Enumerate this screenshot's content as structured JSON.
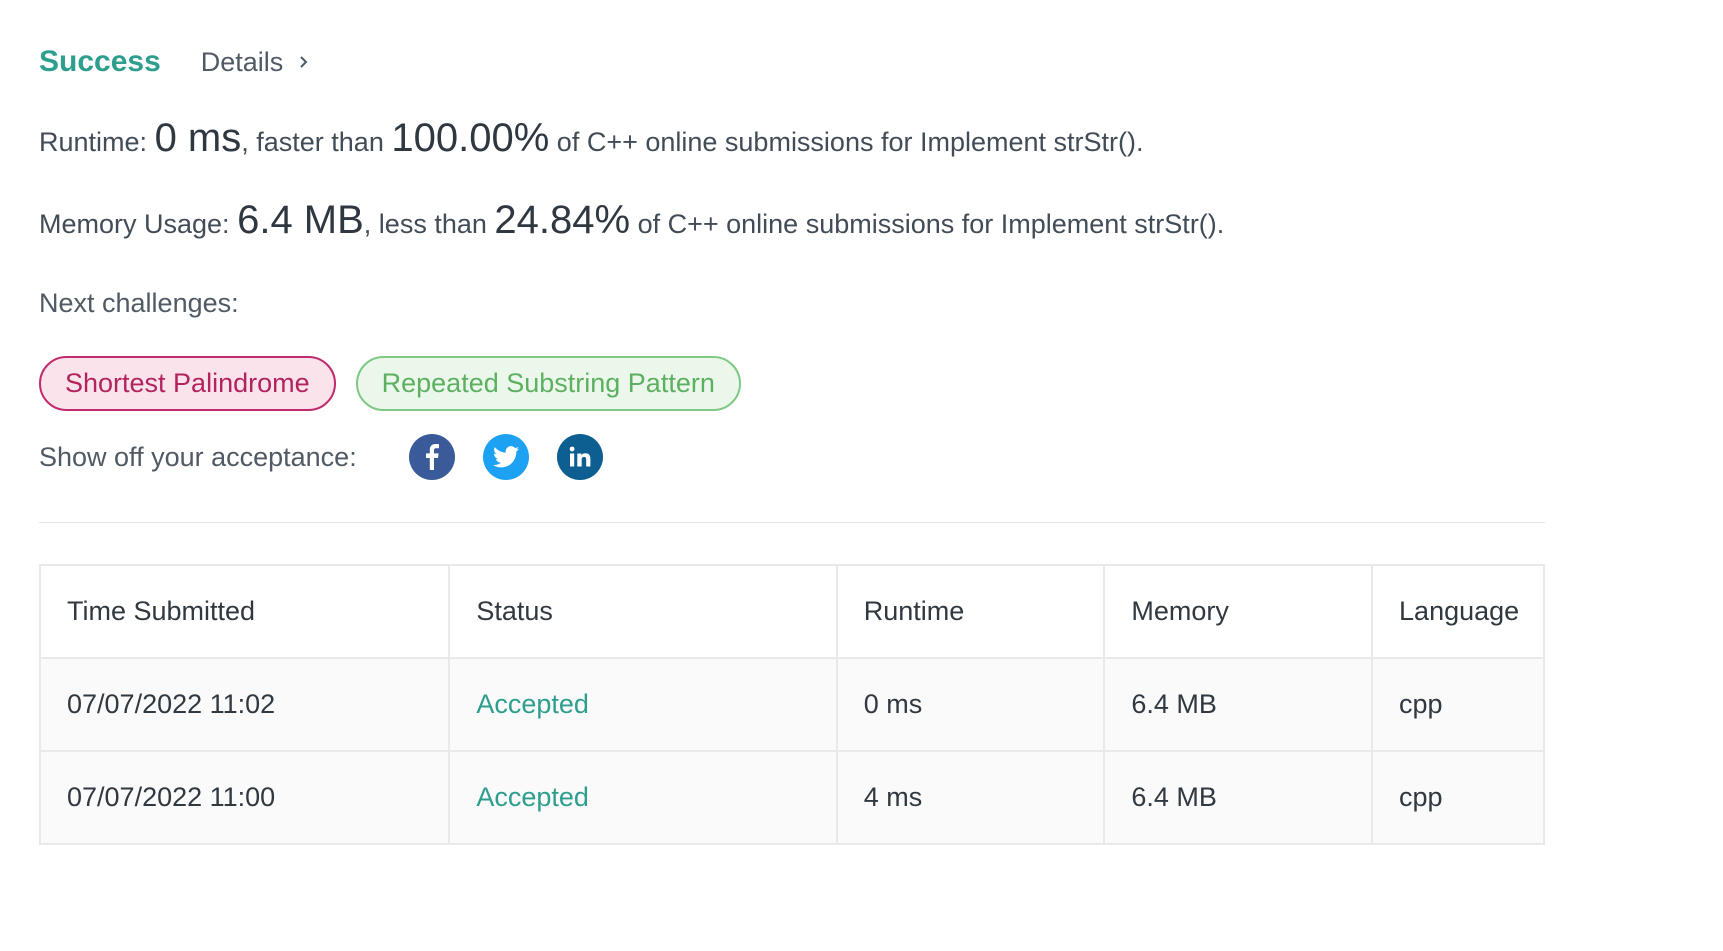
{
  "header": {
    "status": "Success",
    "details_label": "Details"
  },
  "runtime": {
    "label": "Runtime:",
    "value": "0 ms",
    "comparison": ", faster than",
    "percent": "100.00%",
    "suffix": "of C++ online submissions for Implement strStr()."
  },
  "memory": {
    "label": "Memory Usage:",
    "value": "6.4 MB",
    "comparison": ", less than",
    "percent": "24.84%",
    "suffix": "of C++ online submissions for Implement strStr()."
  },
  "next": {
    "label": "Next challenges:",
    "challenges": [
      {
        "title": "Shortest Palindrome",
        "difficulty": "hard",
        "color": "#c12a6d"
      },
      {
        "title": "Repeated Substring Pattern",
        "difficulty": "easy",
        "color": "#5cb060"
      }
    ]
  },
  "share": {
    "label": "Show off your acceptance:",
    "icons": [
      "facebook-icon",
      "twitter-icon",
      "linkedin-icon"
    ]
  },
  "table": {
    "headers": [
      "Time Submitted",
      "Status",
      "Runtime",
      "Memory",
      "Language"
    ],
    "rows": [
      [
        "07/07/2022 11:02",
        "Accepted",
        "0 ms",
        "6.4 MB",
        "cpp"
      ],
      [
        "07/07/2022 11:00",
        "Accepted",
        "4 ms",
        "6.4 MB",
        "cpp"
      ]
    ]
  },
  "colors": {
    "success": "#2e9e8f",
    "hard": "#c12a6d",
    "easy": "#5cb060",
    "facebook": "#3b5a99",
    "twitter": "#1da1f2",
    "linkedin": "#0e5f91"
  }
}
